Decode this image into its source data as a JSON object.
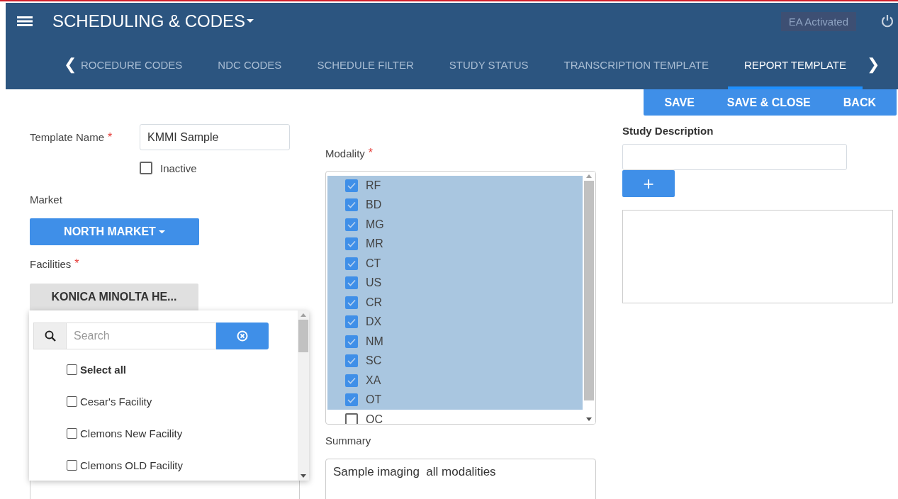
{
  "header": {
    "title": "SCHEDULING & CODES",
    "badge": "EA Activated"
  },
  "tabs": {
    "prev": "❮",
    "next": "❯",
    "items": [
      {
        "label": "ROCEDURE CODES",
        "selected": false
      },
      {
        "label": "NDC CODES",
        "selected": false
      },
      {
        "label": "SCHEDULE FILTER",
        "selected": false
      },
      {
        "label": "STUDY STATUS",
        "selected": false
      },
      {
        "label": "TRANSCRIPTION TEMPLATE",
        "selected": false
      },
      {
        "label": "REPORT TEMPLATE",
        "selected": true
      }
    ]
  },
  "actions": [
    "SAVE",
    "SAVE & CLOSE",
    "BACK"
  ],
  "template_name": {
    "label": "Template Name",
    "required_mark": "*",
    "value": "KMMI Sample"
  },
  "inactive": {
    "label": "Inactive",
    "checked": false
  },
  "market": {
    "label": "Market",
    "button": "NORTH MARKET"
  },
  "facilities": {
    "label": "Facilities",
    "required_mark": "*",
    "button": "KONICA MINOLTA HE...",
    "dropdown": {
      "search_placeholder": "Search",
      "items": [
        {
          "label": "Select all",
          "kind": "all",
          "checked": false
        },
        {
          "label": "Cesar's Facility",
          "kind": "item",
          "checked": false
        },
        {
          "label": "Clemons New Facility",
          "kind": "item",
          "checked": false
        },
        {
          "label": "Clemons OLD Facility",
          "kind": "item",
          "checked": false
        }
      ]
    }
  },
  "modality": {
    "label": "Modality",
    "required_mark": "*",
    "items": [
      {
        "label": "RF",
        "checked": true,
        "selected": true
      },
      {
        "label": "BD",
        "checked": true,
        "selected": true
      },
      {
        "label": "MG",
        "checked": true,
        "selected": true
      },
      {
        "label": "MR",
        "checked": true,
        "selected": true
      },
      {
        "label": "CT",
        "checked": true,
        "selected": true
      },
      {
        "label": "US",
        "checked": true,
        "selected": true
      },
      {
        "label": "CR",
        "checked": true,
        "selected": true
      },
      {
        "label": "DX",
        "checked": true,
        "selected": true
      },
      {
        "label": "NM",
        "checked": true,
        "selected": true
      },
      {
        "label": "SC",
        "checked": true,
        "selected": true
      },
      {
        "label": "XA",
        "checked": true,
        "selected": true
      },
      {
        "label": "OT",
        "checked": true,
        "selected": true
      },
      {
        "label": "OC",
        "checked": false,
        "selected": false
      }
    ]
  },
  "summary": {
    "label": "Summary",
    "value": "Sample imaging  all modalities"
  },
  "study_description": {
    "label": "Study Description",
    "add": "+"
  }
}
